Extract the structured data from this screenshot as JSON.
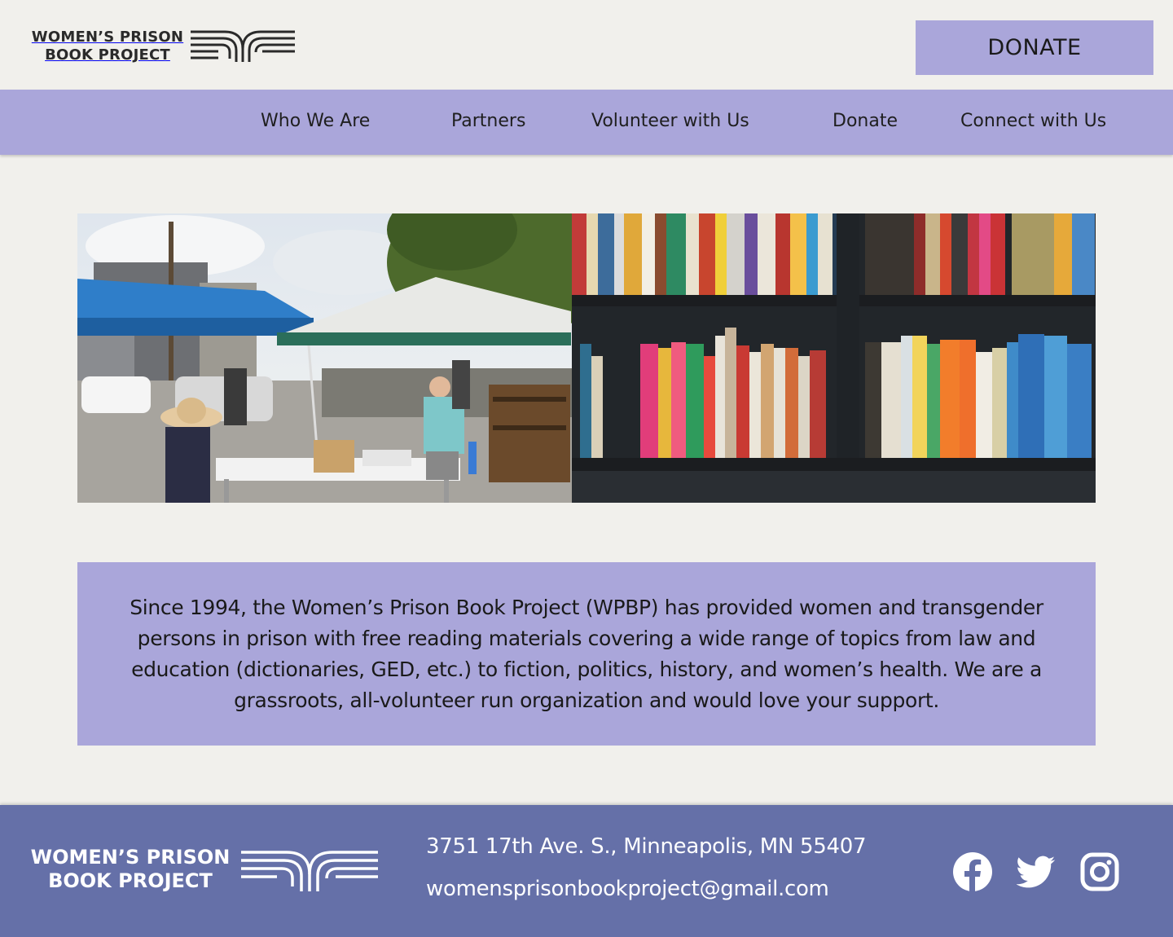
{
  "header": {
    "logo_text_line1": "WOMEN’S PRISON",
    "logo_text_line2": "BOOK PROJECT",
    "donate_button": "DONATE"
  },
  "nav": {
    "items": [
      {
        "label": "Who We Are"
      },
      {
        "label": "Partners"
      },
      {
        "label": "Volunteer with Us"
      },
      {
        "label": "Donate"
      },
      {
        "label": "Connect with Us"
      }
    ]
  },
  "mission": {
    "text": "Since 1994, the Women’s Prison Book Project (WPBP) has provided women and transgender persons in prison with free reading materials covering a wide range of topics from law and education (dictionaries, GED, etc.) to fiction, politics, history, and women’s health. We are a grassroots, all-volunteer run organization and would love your support."
  },
  "footer": {
    "logo_text_line1": "WOMEN’S PRISON",
    "logo_text_line2": "BOOK PROJECT",
    "address": "3751 17th Ave. S., Minneapolis, MN 55407",
    "email": "womensprisonbookproject@gmail.com",
    "social": [
      {
        "icon": "facebook-icon"
      },
      {
        "icon": "twitter-icon"
      },
      {
        "icon": "instagram-icon"
      }
    ]
  },
  "colors": {
    "background": "#f1f0ec",
    "lavender": "#aaa6da",
    "footer": "#6570a8"
  }
}
